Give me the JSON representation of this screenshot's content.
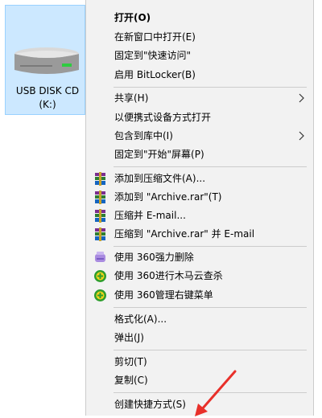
{
  "drive": {
    "label_line1": "USB DISK CD",
    "label_line2": "(K:)"
  },
  "menu": {
    "open": "打开(O)",
    "open_new_window": "在新窗口中打开(E)",
    "pin_quick_access": "固定到\"快速访问\"",
    "bitlocker": "启用 BitLocker(B)",
    "share": "共享(H)",
    "portable_open": "以便携式设备方式打开",
    "include_library": "包含到库中(I)",
    "pin_start": "固定到\"开始\"屏幕(P)",
    "add_archive": "添加到压缩文件(A)...",
    "add_archive_rar": "添加到 \"Archive.rar\"(T)",
    "compress_email": "压缩并 E-mail...",
    "compress_rar_email": "压缩到 \"Archive.rar\" 并 E-mail",
    "s360_delete": "使用 360强力删除",
    "s360_scan": "使用 360进行木马云查杀",
    "s360_manage": "使用 360管理右键菜单",
    "format": "格式化(A)...",
    "eject": "弹出(J)",
    "cut": "剪切(T)",
    "copy": "复制(C)",
    "create_shortcut": "创建快捷方式(S)"
  },
  "colors": {
    "menu_bg": "#f2f2f2",
    "selection_bg": "#cce8ff",
    "annotation_arrow": "#e8302a"
  }
}
